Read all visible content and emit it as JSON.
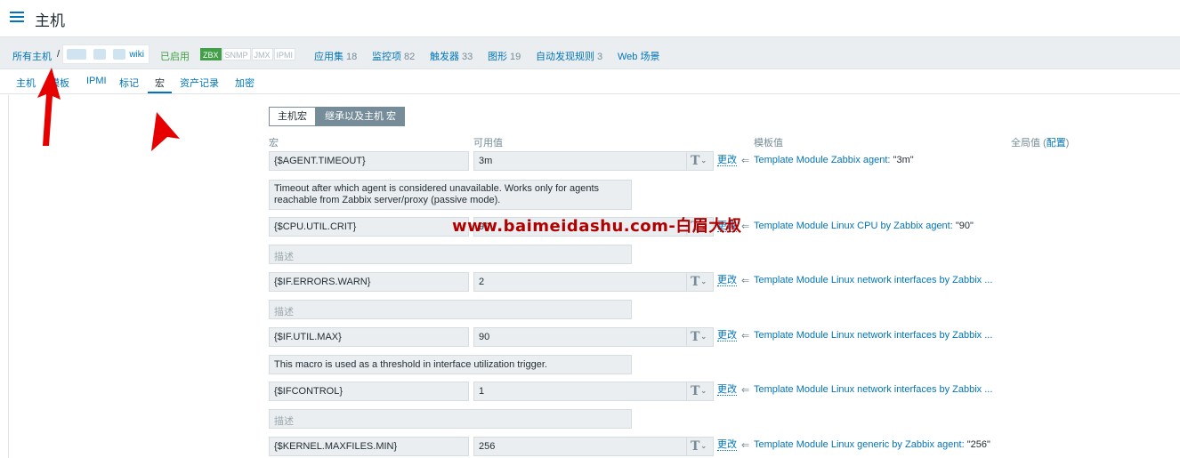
{
  "header": {
    "title": "主机"
  },
  "breadcrumb": {
    "all_hosts": "所有主机",
    "separator": "/",
    "host_suffix": "wiki",
    "status": "已启用",
    "availability": [
      "ZBX",
      "SNMP",
      "JMX",
      "IPMI"
    ],
    "links": [
      {
        "label": "应用集",
        "count": "18"
      },
      {
        "label": "监控项",
        "count": "82"
      },
      {
        "label": "触发器",
        "count": "33"
      },
      {
        "label": "图形",
        "count": "19"
      },
      {
        "label": "自动发现规则",
        "count": "3"
      },
      {
        "label": "Web 场景",
        "count": ""
      }
    ]
  },
  "tabs": [
    "主机",
    "模板",
    "IPMI",
    "标记",
    "宏",
    "资产记录",
    "加密"
  ],
  "segment": {
    "host_macros": "主机宏",
    "inherited": "继承以及主机 宏"
  },
  "columns": {
    "macro": "宏",
    "effective": "可用值",
    "template": "模板值",
    "global": "全局值 (",
    "global_link": "配置",
    "global_close": ")"
  },
  "macros": [
    {
      "name": "{$AGENT.TIMEOUT}",
      "value": "3m",
      "description": "Timeout after which agent is considered unavailable. Works only for agents reachable from Zabbix server/proxy (passive mode).",
      "template": "Template Module Zabbix agent:",
      "template_value": "\"3m\""
    },
    {
      "name": "{$CPU.UTIL.CRIT}",
      "value": "90",
      "description": "描述",
      "template": "Template Module Linux CPU by Zabbix agent:",
      "template_value": "\"90\""
    },
    {
      "name": "{$IF.ERRORS.WARN}",
      "value": "2",
      "description": "描述",
      "template": "Template Module Linux network interfaces by Zabbix ...",
      "template_value": ""
    },
    {
      "name": "{$IF.UTIL.MAX}",
      "value": "90",
      "description": "This macro is used as a threshold in interface utilization trigger.",
      "template": "Template Module Linux network interfaces by Zabbix ...",
      "template_value": ""
    },
    {
      "name": "{$IFCONTROL}",
      "value": "1",
      "description": "描述",
      "template": "Template Module Linux network interfaces by Zabbix ...",
      "template_value": ""
    },
    {
      "name": "{$KERNEL.MAXFILES.MIN}",
      "value": "256",
      "description": "",
      "template": "Template Module Linux generic by Zabbix agent:",
      "template_value": "\"256\""
    }
  ],
  "row_actions": {
    "change": "更改",
    "inherit_arrow": "⇐",
    "type_icon": "T",
    "type_caret": "⌄"
  },
  "watermark": "www.baimeidashu.com-白眉大叔",
  "colors": {
    "link": "#0275b8",
    "enabled": "#429e47",
    "watermark": "#b00000",
    "annotation": "#e60000"
  }
}
